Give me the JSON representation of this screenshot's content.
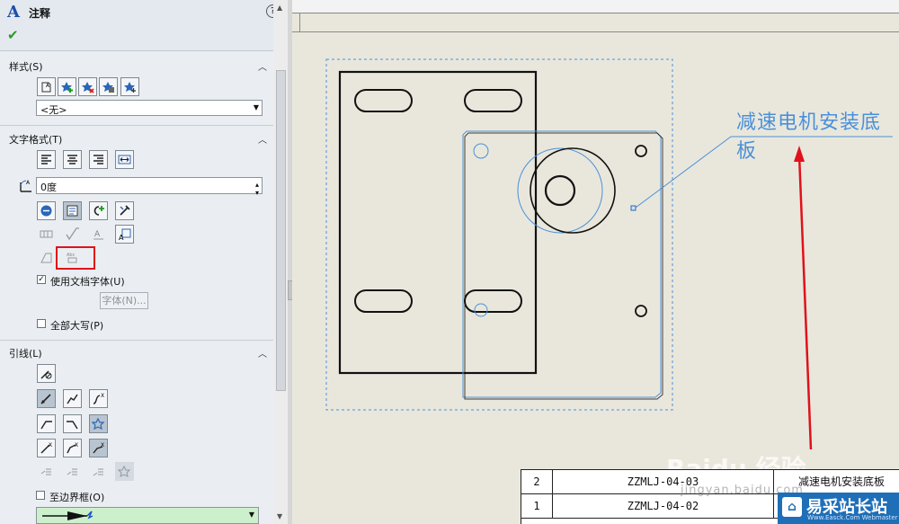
{
  "panel": {
    "logo": "A",
    "title": "注释",
    "help": "?",
    "ok": "✔"
  },
  "style_group": {
    "title": "样式(S)",
    "select_value": "<无>"
  },
  "text_format_group": {
    "title": "文字格式(T)",
    "angle_value": "0度",
    "use_doc_font_label": "使用文档字体(U)",
    "use_doc_font_checked": true,
    "font_button": "字体(N)...",
    "all_caps_label": "全部大写(P)",
    "all_caps_checked": false
  },
  "leader_group": {
    "title": "引线(L)",
    "border_label": "至边界框(O)",
    "border_checked": false
  },
  "drawing": {
    "note": "减速电机安装底板",
    "bom": [
      {
        "no": "2",
        "code": "ZZMLJ-04-03",
        "name": "减速电机安装底板"
      },
      {
        "no": "1",
        "code": "ZZMLJ-04-02",
        "name": ""
      }
    ]
  },
  "watermark": {
    "brand": "Baidu 经验",
    "url": "jingyan.baidu.com",
    "site_name": "易采站长站",
    "site_sub": "Www.Easck.Com Webmaster"
  },
  "colors": {
    "annotation_blue": "#4a90d9",
    "highlight_red": "#e0111b",
    "arrow_red": "#e0111b",
    "panel_bg": "#eaeef2",
    "sheet_bg": "#e9e7dc"
  }
}
